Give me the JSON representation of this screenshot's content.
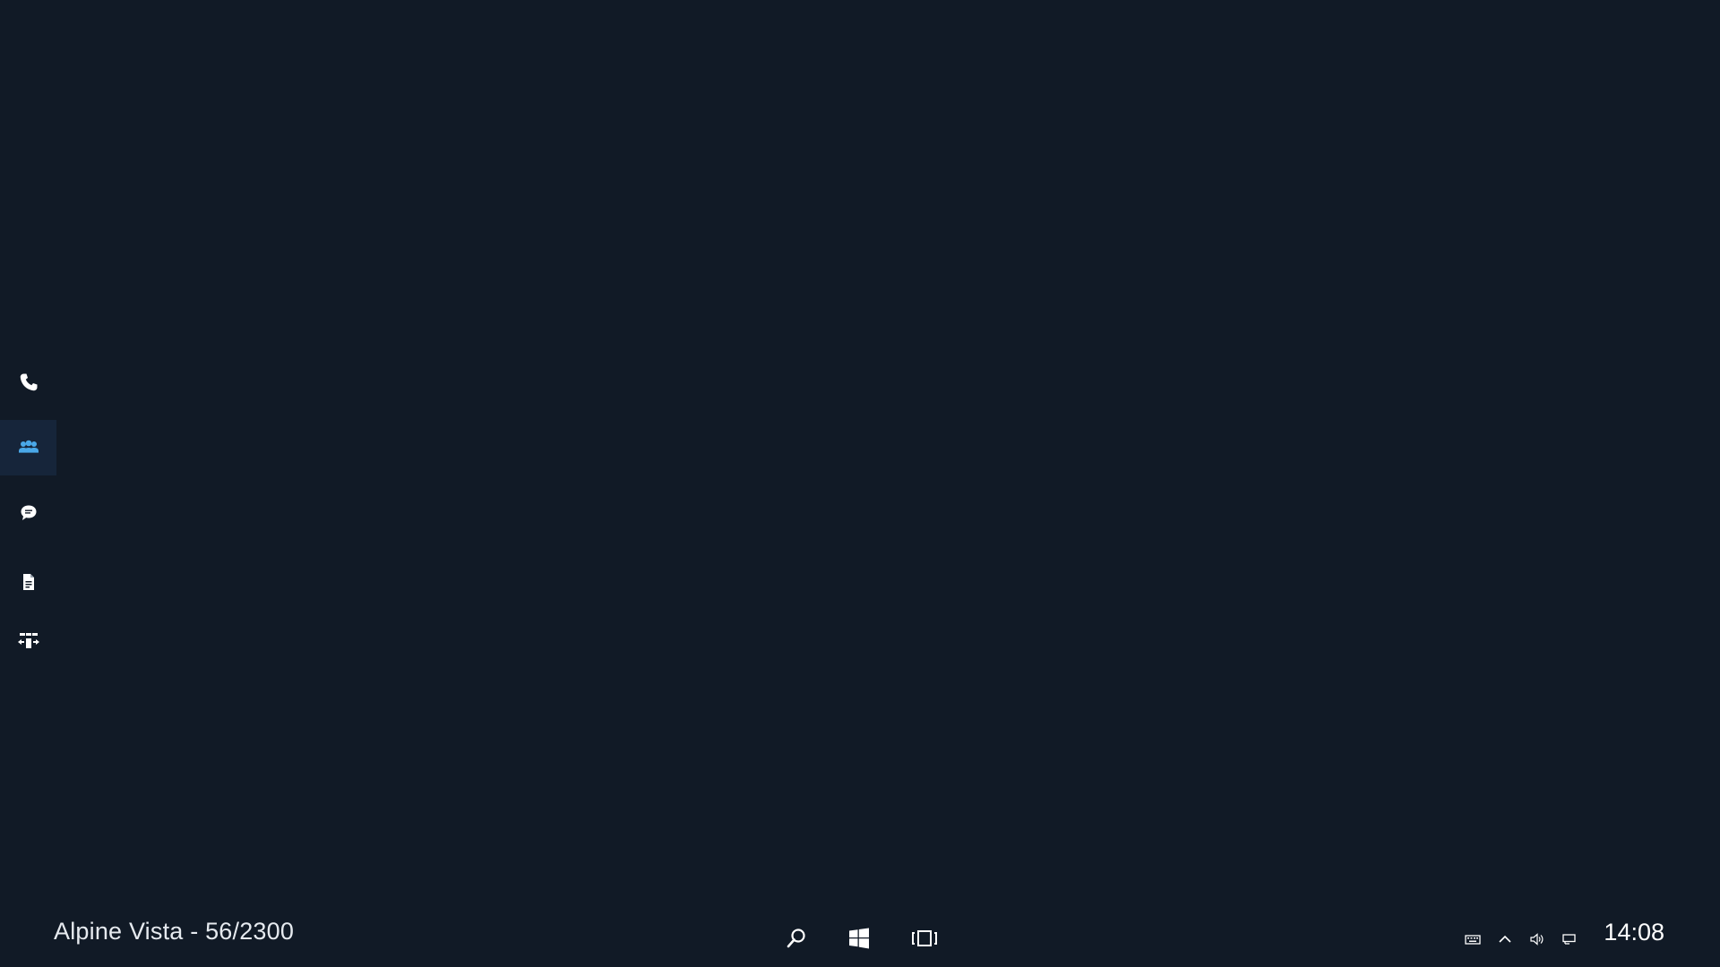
{
  "taskbar": {
    "device_label": "Alpine Vista - 56/2300",
    "clock": "14:08",
    "buttons": [
      "search-icon",
      "windows-start-icon",
      "task-view-icon"
    ],
    "tray": [
      "keyboard-icon",
      "chevron-up-icon",
      "volume-icon",
      "display-icon"
    ]
  },
  "rail": {
    "items": [
      {
        "icon": "phone-icon",
        "active": false
      },
      {
        "icon": "people-icon",
        "active": true
      },
      {
        "icon": "chat-icon",
        "active": false
      },
      {
        "icon": "document-icon",
        "active": false
      },
      {
        "icon": "transfer-icon",
        "active": false
      }
    ]
  },
  "colors": {
    "background": "#111a26",
    "active_item": "#16253a",
    "accent": "#4aa8e8",
    "icon": "#ffffff"
  }
}
